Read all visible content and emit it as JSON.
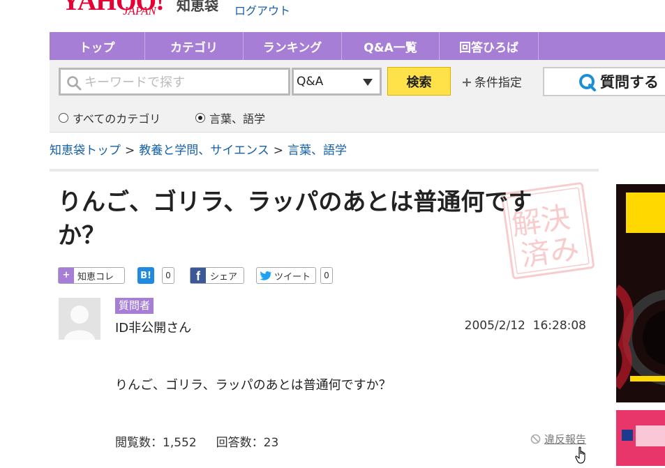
{
  "header": {
    "logo_text": "YAHOO!",
    "logo_sub": "JAPAN",
    "service_name": "知恵袋",
    "logout_label": "ログアウト"
  },
  "nav": {
    "tabs": [
      {
        "label": "トップ"
      },
      {
        "label": "カテゴリ"
      },
      {
        "label": "ランキング"
      },
      {
        "label": "Q&A一覧"
      },
      {
        "label": "回答ひろば"
      }
    ]
  },
  "search": {
    "placeholder": "キーワードで探す",
    "type_selected": "Q&A",
    "search_button": "検索",
    "conditions_label": "条件指定",
    "ask_button": "質問する",
    "scope_options": [
      {
        "label": "すべてのカテゴリ",
        "selected": false
      },
      {
        "label": "言葉、語学",
        "selected": true
      }
    ]
  },
  "breadcrumb": {
    "items": [
      "知恵袋トップ",
      "教養と学問、サイエンス",
      "言葉、語学"
    ],
    "separator": ">"
  },
  "question": {
    "title": "りんご、ゴリラ、ラッパのあとは普通何ですか？",
    "stamp_text": "解決済み",
    "share": {
      "chiekore_label": "知恵コレ",
      "hatena_label": "B!",
      "hatena_count": "0",
      "facebook_label": "シェア",
      "tweet_label": "ツイート",
      "tweet_count": "0"
    },
    "role_badge": "質問者",
    "asker": "ID非公開さん",
    "date": "2005/2/12  16:28:08",
    "body": "りんご、ゴリラ、ラッパのあとは普通何ですか？",
    "views_label": "閲覧数：1,552",
    "answers_label": "回答数：23",
    "report_label": "違反報告"
  },
  "colors": {
    "nav": "#a67ed6",
    "search_button": "#ffe14a",
    "link": "#1560a8"
  }
}
